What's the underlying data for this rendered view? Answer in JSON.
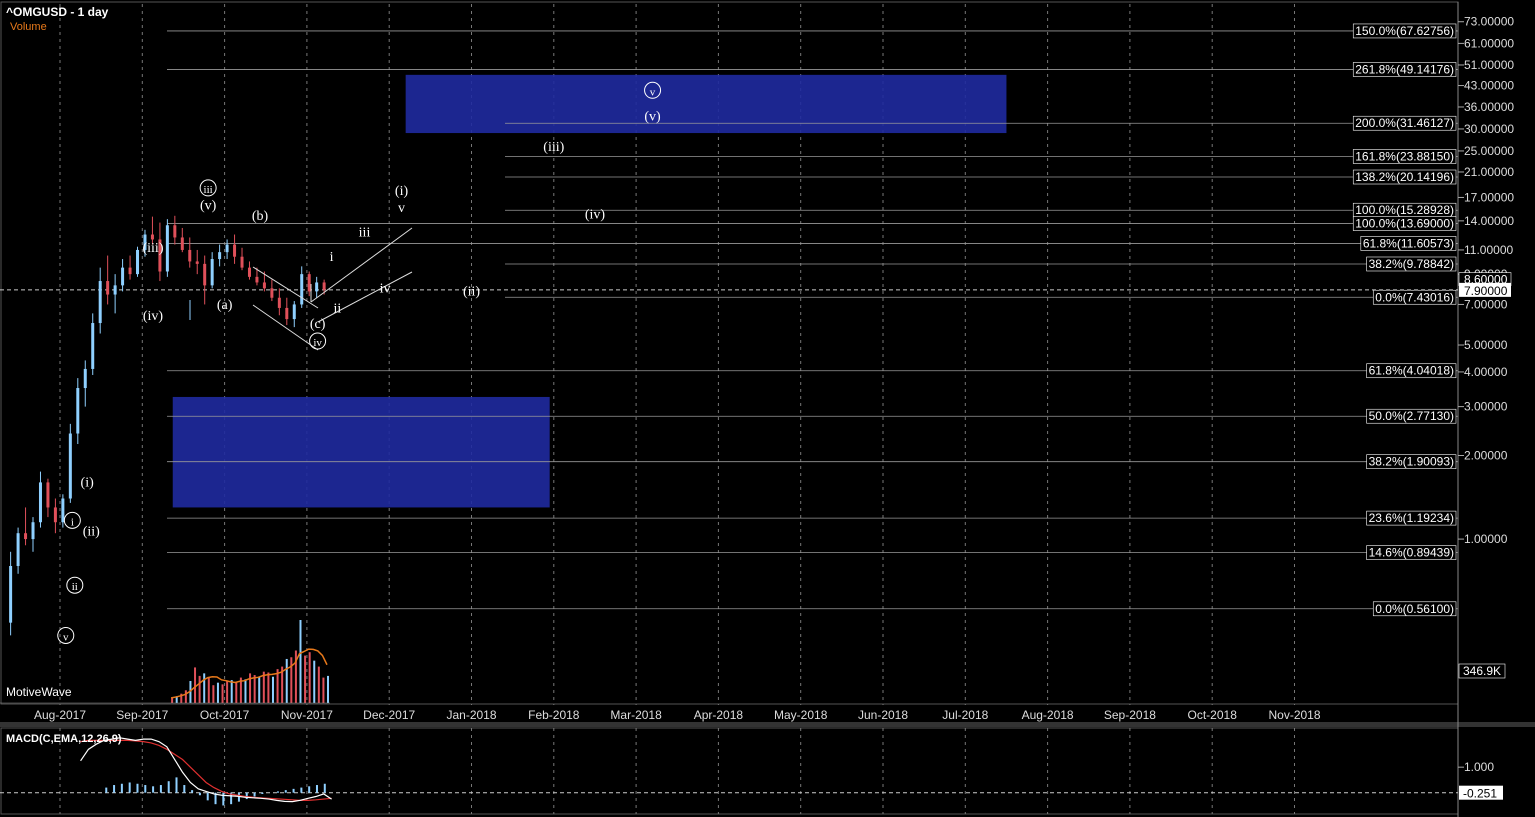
{
  "header": {
    "title": "^OMGUSD - 1 day",
    "volume_label": "Volume",
    "brand": "MotiveWave",
    "macd_label": "MACD(C,EMA,12,26,9)"
  },
  "colors": {
    "background": "#000000",
    "grid": "#777777",
    "zone": "#1f2aa0",
    "candle_up": "#8fd0ff",
    "candle_down": "#e0505a",
    "volume_up": "#8fd0ff",
    "volume_down": "#e0505a",
    "volume_avg": "#e8791a",
    "macd_line": "#ffffff",
    "signal_line": "#e03030",
    "histogram": "#8fd0ff"
  },
  "chart_data": {
    "type": "candlestick",
    "scale": "log",
    "x_ticks": [
      "Aug-2017",
      "Sep-2017",
      "Oct-2017",
      "Nov-2017",
      "Dec-2017",
      "Jan-2018",
      "Feb-2018",
      "Mar-2018",
      "Apr-2018",
      "May-2018",
      "Jun-2018",
      "Jul-2018",
      "Aug-2018",
      "Sep-2018",
      "Oct-2018",
      "Nov-2018"
    ],
    "y_ticks": [
      "73.00000",
      "61.00000",
      "51.00000",
      "43.00000",
      "36.00000",
      "30.00000",
      "25.00000",
      "21.00000",
      "17.00000",
      "14.00000",
      "11.00000",
      "9.00000",
      "7.00000",
      "5.00000",
      "4.00000",
      "3.00000",
      "2.00000",
      "1.00000"
    ],
    "price_labels": {
      "current": "7.90000",
      "marker": "8.60000",
      "volume": "346.9K",
      "macd_tick": "1.000",
      "macd_current": "-0.251"
    },
    "fib_levels": [
      {
        "label": "150.0%(67.62756)",
        "price": 67.63
      },
      {
        "label": "261.8%(49.14176)",
        "price": 49.14
      },
      {
        "label": "200.0%(31.46127)",
        "price": 31.46
      },
      {
        "label": "161.8%(23.88150)",
        "price": 23.88
      },
      {
        "label": "138.2%(20.14196)",
        "price": 20.14
      },
      {
        "label": "100.0%(15.28928)",
        "price": 15.29
      },
      {
        "label": "100.0%(13.69000)",
        "price": 13.69
      },
      {
        "label": "61.8%(11.60573)",
        "price": 11.61
      },
      {
        "label": "38.2%(9.78842)",
        "price": 9.79
      },
      {
        "label": "0.0%(7.43016)",
        "price": 7.43
      },
      {
        "label": "61.8%(4.04018)",
        "price": 4.04
      },
      {
        "label": "50.0%(2.77130)",
        "price": 2.77
      },
      {
        "label": "38.2%(1.90093)",
        "price": 1.9
      },
      {
        "label": "23.6%(1.19234)",
        "price": 1.19
      },
      {
        "label": "14.6%(0.89439)",
        "price": 0.894
      },
      {
        "label": "0.0%(0.56100)",
        "price": 0.561
      }
    ],
    "zones": [
      {
        "from_month": 4.2,
        "to_month": 11.5,
        "low": 29.0,
        "high": 47.0
      },
      {
        "from_month": 1.37,
        "to_month": 5.95,
        "low": 1.3,
        "high": 3.25
      }
    ],
    "wave_labels": [
      {
        "text": "(iii)",
        "month": 6.0,
        "price": 25.2
      },
      {
        "text": "(v)",
        "month": 7.2,
        "price": 32.5
      },
      {
        "text": "v",
        "month": 7.2,
        "price": 40.0,
        "circled": true
      },
      {
        "text": "(iv)",
        "month": 6.5,
        "price": 14.4
      },
      {
        "text": "(ii)",
        "month": 5.0,
        "price": 7.6
      },
      {
        "text": "(i)",
        "month": 4.15,
        "price": 17.5
      },
      {
        "text": "v",
        "month": 4.15,
        "price": 15.2
      },
      {
        "text": "iii",
        "month": 3.7,
        "price": 12.4
      },
      {
        "text": "iv",
        "month": 3.95,
        "price": 7.8
      },
      {
        "text": "i",
        "month": 3.3,
        "price": 10.1
      },
      {
        "text": "ii",
        "month": 3.37,
        "price": 6.6
      },
      {
        "text": "(b)",
        "month": 2.43,
        "price": 14.2
      },
      {
        "text": "(a)",
        "month": 2.0,
        "price": 6.8
      },
      {
        "text": "(c)",
        "month": 3.13,
        "price": 5.8
      },
      {
        "text": "iv",
        "month": 3.13,
        "price": 5.0,
        "circled": true
      },
      {
        "text": "(v)",
        "month": 1.8,
        "price": 15.5
      },
      {
        "text": "iii",
        "month": 1.8,
        "price": 17.8,
        "circled": true
      },
      {
        "text": "(iii)",
        "month": 1.13,
        "price": 10.9
      },
      {
        "text": "(iv)",
        "month": 1.13,
        "price": 6.2
      },
      {
        "text": "(i)",
        "month": 0.33,
        "price": 1.56
      },
      {
        "text": "(ii)",
        "month": 0.38,
        "price": 1.04
      },
      {
        "text": "i",
        "month": 0.15,
        "price": 1.13,
        "circled": true
      },
      {
        "text": "ii",
        "month": 0.18,
        "price": 0.66,
        "circled": true
      },
      {
        "text": "v",
        "month": 0.07,
        "price": 0.435,
        "circled": true
      }
    ],
    "ohlc": [
      [
        0.5,
        0.9,
        0.45,
        0.8
      ],
      [
        0.8,
        1.1,
        0.75,
        1.05
      ],
      [
        1.05,
        1.3,
        0.95,
        1.0
      ],
      [
        1.0,
        1.2,
        0.9,
        1.15
      ],
      [
        1.15,
        1.75,
        1.1,
        1.6
      ],
      [
        1.6,
        1.65,
        1.2,
        1.3
      ],
      [
        1.3,
        1.4,
        1.05,
        1.15
      ],
      [
        1.15,
        1.45,
        1.1,
        1.4
      ],
      [
        1.4,
        2.6,
        1.35,
        2.4
      ],
      [
        2.4,
        3.8,
        2.2,
        3.5
      ],
      [
        3.5,
        4.4,
        3.0,
        4.1
      ],
      [
        4.1,
        6.5,
        3.9,
        6.0
      ],
      [
        6.0,
        9.5,
        5.5,
        8.5
      ],
      [
        8.5,
        10.5,
        7.0,
        7.6
      ],
      [
        7.6,
        9.0,
        6.5,
        8.2
      ],
      [
        8.2,
        10.2,
        7.8,
        9.5
      ],
      [
        9.5,
        10.5,
        8.6,
        9.0
      ],
      [
        9.0,
        11.3,
        8.8,
        11.0
      ],
      [
        11.0,
        13.0,
        10.4,
        12.5
      ],
      [
        12.5,
        14.5,
        11.5,
        12.0
      ],
      [
        12.0,
        13.8,
        8.5,
        9.2
      ],
      [
        9.2,
        14.2,
        8.8,
        13.5
      ],
      [
        13.5,
        14.6,
        11.5,
        12.2
      ],
      [
        12.2,
        13.2,
        10.8,
        11.0
      ],
      [
        11.0,
        12.2,
        9.5,
        10.0
      ],
      [
        10.0,
        11.0,
        9.0,
        9.8
      ],
      [
        9.8,
        10.5,
        7.0,
        8.2
      ],
      [
        8.2,
        10.8,
        8.0,
        10.2
      ],
      [
        10.2,
        11.5,
        9.6,
        10.8
      ],
      [
        10.8,
        12.0,
        10.2,
        11.5
      ],
      [
        11.5,
        12.5,
        9.8,
        10.4
      ],
      [
        10.4,
        11.2,
        9.3,
        9.5
      ],
      [
        9.5,
        10.0,
        8.6,
        8.8
      ],
      [
        8.8,
        9.5,
        8.2,
        8.4
      ],
      [
        8.4,
        9.2,
        7.8,
        8.0
      ],
      [
        8.0,
        8.6,
        7.2,
        7.4
      ],
      [
        7.4,
        8.0,
        6.4,
        6.8
      ],
      [
        6.8,
        7.4,
        5.9,
        6.2
      ],
      [
        6.2,
        7.2,
        5.8,
        7.0
      ],
      [
        7.0,
        9.6,
        6.8,
        9.0
      ],
      [
        9.0,
        9.2,
        7.5,
        7.8
      ],
      [
        7.8,
        8.8,
        7.4,
        8.4
      ],
      [
        8.4,
        8.6,
        7.6,
        7.9
      ]
    ],
    "volume": {
      "max_k": 980,
      "values": [
        60,
        80,
        110,
        150,
        260,
        420,
        320,
        350,
        300,
        210,
        240,
        220,
        260,
        270,
        250,
        300,
        280,
        350,
        330,
        310,
        370,
        360,
        310,
        400,
        430,
        520,
        540,
        620,
        980,
        560,
        600,
        500,
        430,
        300,
        320
      ]
    },
    "macd": {
      "y_range": [
        -0.6,
        2.3
      ],
      "macd": [
        1.25,
        1.7,
        1.9,
        2.05,
        2.1,
        2.15,
        2.1,
        2.05,
        2.1,
        2.1,
        2.0,
        1.8,
        1.3,
        0.8,
        0.4,
        0.15,
        0.05,
        -0.05,
        -0.1,
        -0.12,
        -0.14,
        -0.18,
        -0.2,
        -0.22,
        -0.25,
        -0.3,
        -0.34,
        -0.35,
        -0.3,
        -0.22,
        -0.15,
        -0.05,
        -0.25
      ],
      "signal": [
        2.0,
        2.05,
        2.05,
        2.05,
        2.05,
        2.05,
        2.05,
        2.03,
        2.0,
        1.95,
        1.85,
        1.7,
        1.5,
        1.3,
        1.0,
        0.7,
        0.4,
        0.2,
        0.05,
        -0.05,
        -0.1,
        -0.15,
        -0.18,
        -0.2,
        -0.22,
        -0.24,
        -0.26,
        -0.28,
        -0.3,
        -0.3,
        -0.28,
        -0.25,
        -0.22
      ],
      "hist": [
        0.2,
        0.3,
        0.35,
        0.4,
        0.35,
        0.3,
        0.25,
        0.3,
        0.45,
        0.6,
        0.3,
        0.1,
        -0.1,
        -0.3,
        -0.45,
        -0.5,
        -0.45,
        -0.35,
        -0.25,
        -0.15,
        -0.05,
        0.0,
        0.05,
        0.1,
        0.15,
        0.2,
        0.25,
        0.3,
        0.35
      ]
    }
  }
}
